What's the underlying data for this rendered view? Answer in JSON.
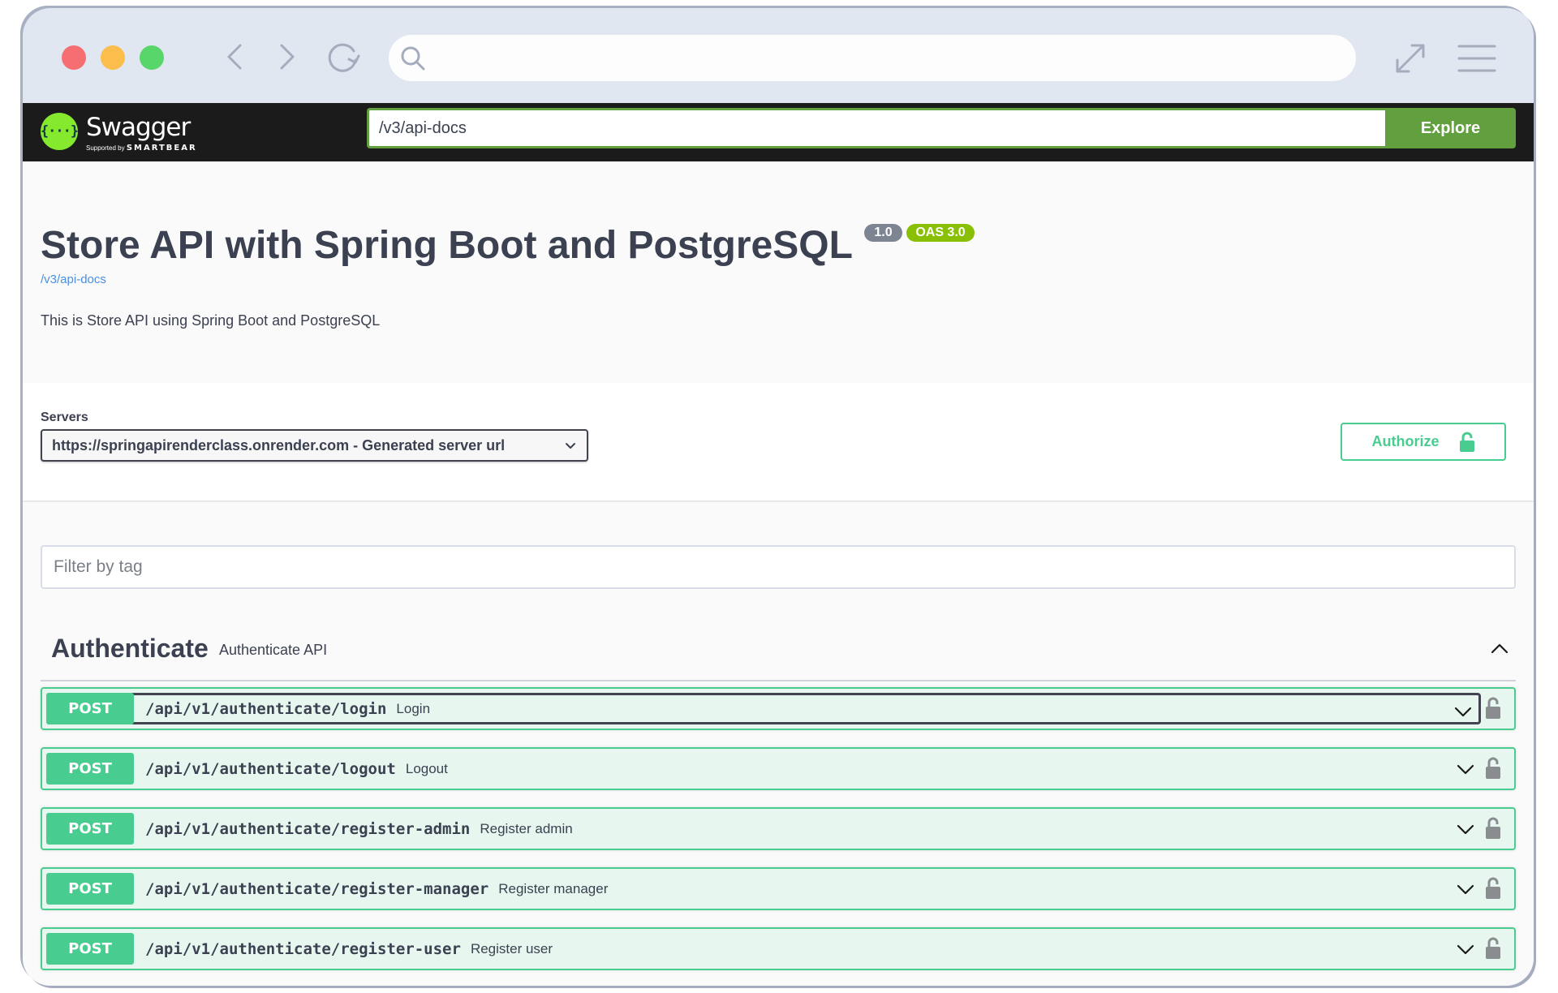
{
  "browser": {
    "address_value": "",
    "icons": [
      "close-dot",
      "minimize-dot",
      "maximize-dot",
      "back-icon",
      "forward-icon",
      "reload-icon",
      "search-icon",
      "expand-icon",
      "menu-icon"
    ]
  },
  "topbar": {
    "logo_text": "Swagger",
    "logo_glyph": "{···}",
    "logo_sub_prefix": "Supported by",
    "logo_sub_brand": "SMARTBEAR",
    "spec_url_value": "/v3/api-docs",
    "explore_label": "Explore",
    "colors": {
      "background": "#1b1b1b",
      "accent": "#62a03f",
      "logo": "#85ea2d"
    }
  },
  "info": {
    "title": "Store API with Spring Boot and PostgreSQL",
    "version_badge": "1.0",
    "oas_badge": "OAS 3.0",
    "spec_link": "/v3/api-docs",
    "description": "This is Store API using Spring Boot and PostgreSQL"
  },
  "servers": {
    "label": "Servers",
    "selected": "https://springapirenderclass.onrender.com - Generated server url"
  },
  "authorize": {
    "label": "Authorize",
    "icon": "unlock-icon",
    "color": "#49cc90"
  },
  "filter": {
    "placeholder": "Filter by tag",
    "value": ""
  },
  "tag": {
    "name": "Authenticate",
    "description": "Authenticate API",
    "expanded": true
  },
  "operations": [
    {
      "method": "POST",
      "path": "/api/v1/authenticate/login",
      "summary": "Login",
      "focused": true
    },
    {
      "method": "POST",
      "path": "/api/v1/authenticate/logout",
      "summary": "Logout",
      "focused": false
    },
    {
      "method": "POST",
      "path": "/api/v1/authenticate/register-admin",
      "summary": "Register admin",
      "focused": false
    },
    {
      "method": "POST",
      "path": "/api/v1/authenticate/register-manager",
      "summary": "Register manager",
      "focused": false
    },
    {
      "method": "POST",
      "path": "/api/v1/authenticate/register-user",
      "summary": "Register user",
      "focused": false
    }
  ],
  "colors": {
    "post": "#49cc90",
    "post_bg": "#e8f6f0",
    "text": "#3b4151",
    "version_badge": "#7d8492",
    "oas_badge": "#89bf04",
    "link": "#4990e2"
  }
}
